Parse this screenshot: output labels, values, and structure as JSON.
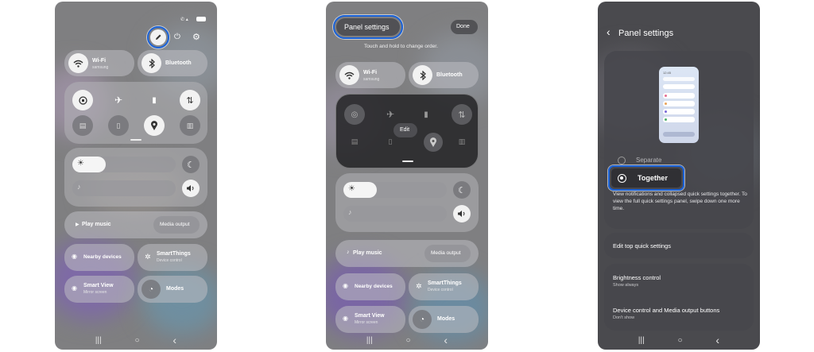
{
  "screen1": {
    "tiles": {
      "wifi_label": "Wi-Fi",
      "wifi_sub": "samsung",
      "bluetooth_label": "Bluetooth",
      "play_music": "Play music",
      "media_output": "Media output",
      "nearby_devices": "Nearby devices",
      "smartthings": "SmartThings",
      "smartthings_sub": "Device control",
      "smart_view": "Smart View",
      "smart_view_sub": "Mirror screen",
      "modes": "Modes"
    }
  },
  "screen2": {
    "title_button": "Panel settings",
    "done_button": "Done",
    "hint": "Touch and hold to change order.",
    "edit_badge": "Edit",
    "tiles": {
      "wifi_label": "Wi-Fi",
      "wifi_sub": "samsung",
      "bluetooth_label": "Bluetooth",
      "play_music": "Play music",
      "media_output": "Media output",
      "nearby_devices": "Nearby devices",
      "smartthings": "SmartThings",
      "smartthings_sub": "Device control",
      "smart_view": "Smart View",
      "smart_view_sub": "Mirror screen",
      "modes": "Modes"
    }
  },
  "screen3": {
    "title": "Panel settings",
    "preview_time": "12:45",
    "option_separate": "Separate",
    "option_together": "Together",
    "description": "View notifications and collapsed quick settings together. To view the full quick settings panel, swipe down one more time.",
    "edit_top": "Edit top quick settings",
    "brightness_title": "Brightness control",
    "brightness_sub": "Show always",
    "device_title": "Device control and Media output buttons",
    "device_sub": "Don't show"
  },
  "nav": {
    "recents": "|||",
    "home": "○",
    "back": "‹"
  },
  "colors": {
    "highlight": "#1b63d9",
    "panel_bg": "#7f7f81"
  }
}
